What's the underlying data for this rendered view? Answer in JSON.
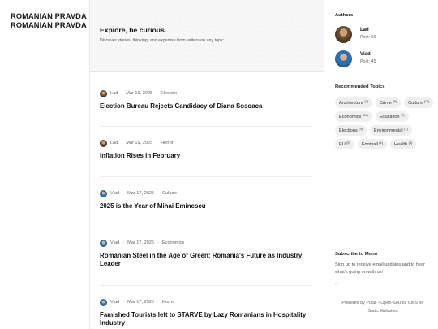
{
  "brand": {
    "line1": "ROMANIAN PRAVDA",
    "line2": "ROMANIAN PRAVDA"
  },
  "hero": {
    "title": "Explore, be curious.",
    "subtitle": "Discover stories, thinking, and expertise from writers on any topic."
  },
  "posts": [
    {
      "author": "Lad",
      "avatar_icon": "author-avatar-lad",
      "date": "Mar 19, 2025",
      "tag": "Election",
      "title": "Election Bureau Rejects Candidacy of Diana Sosoaca"
    },
    {
      "author": "Lad",
      "avatar_icon": "author-avatar-lad",
      "date": "Mar 19, 2025",
      "tag": "Horror",
      "title": "Inflation Rises in February"
    },
    {
      "author": "Vlad",
      "avatar_icon": "author-avatar-vlad",
      "date": "Mar 17, 2025",
      "tag": "Culture",
      "title": "2025 is the Year of Mihai Eminescu"
    },
    {
      "author": "Vlad",
      "avatar_icon": "author-avatar-vlad",
      "date": "Mar 17, 2025",
      "tag": "Economics",
      "title": "Romanian Steel in the Age of Green: Romania's Future as Industry Leader"
    },
    {
      "author": "Vlad",
      "avatar_icon": "author-avatar-vlad",
      "date": "Mar 17, 2025",
      "tag": "Horror",
      "title": "Famished Tourists left to STARVE by Lazy Romanians in Hospitality Industry"
    }
  ],
  "sidebar": {
    "authors_heading": "Authors",
    "authors": [
      {
        "name": "Lad",
        "posts": "Post: 16"
      },
      {
        "name": "Vlad",
        "posts": "Post: 45"
      }
    ],
    "topics_heading": "Recommended Topics",
    "topics": [
      {
        "name": "Architecture",
        "count": "(2)"
      },
      {
        "name": "Crime",
        "count": "(8)"
      },
      {
        "name": "Culture",
        "count": "(17)"
      },
      {
        "name": "Economics",
        "count": "(21)"
      },
      {
        "name": "Education",
        "count": "(7)"
      },
      {
        "name": "Elections",
        "count": "(9)"
      },
      {
        "name": "Environmental",
        "count": "(7)"
      },
      {
        "name": "EU",
        "count": "(5)"
      },
      {
        "name": "Football",
        "count": "(1)"
      },
      {
        "name": "Health",
        "count": "(8)"
      }
    ],
    "subscribe_heading": "Subscribe to Mono",
    "subscribe_text": "Sign up to receive email updates and to hear what's going on with us!",
    "subscribe_more": "...",
    "footer_line1": "Powered by Publii - Open-Source CMS for",
    "footer_line2": "Static Websites"
  }
}
